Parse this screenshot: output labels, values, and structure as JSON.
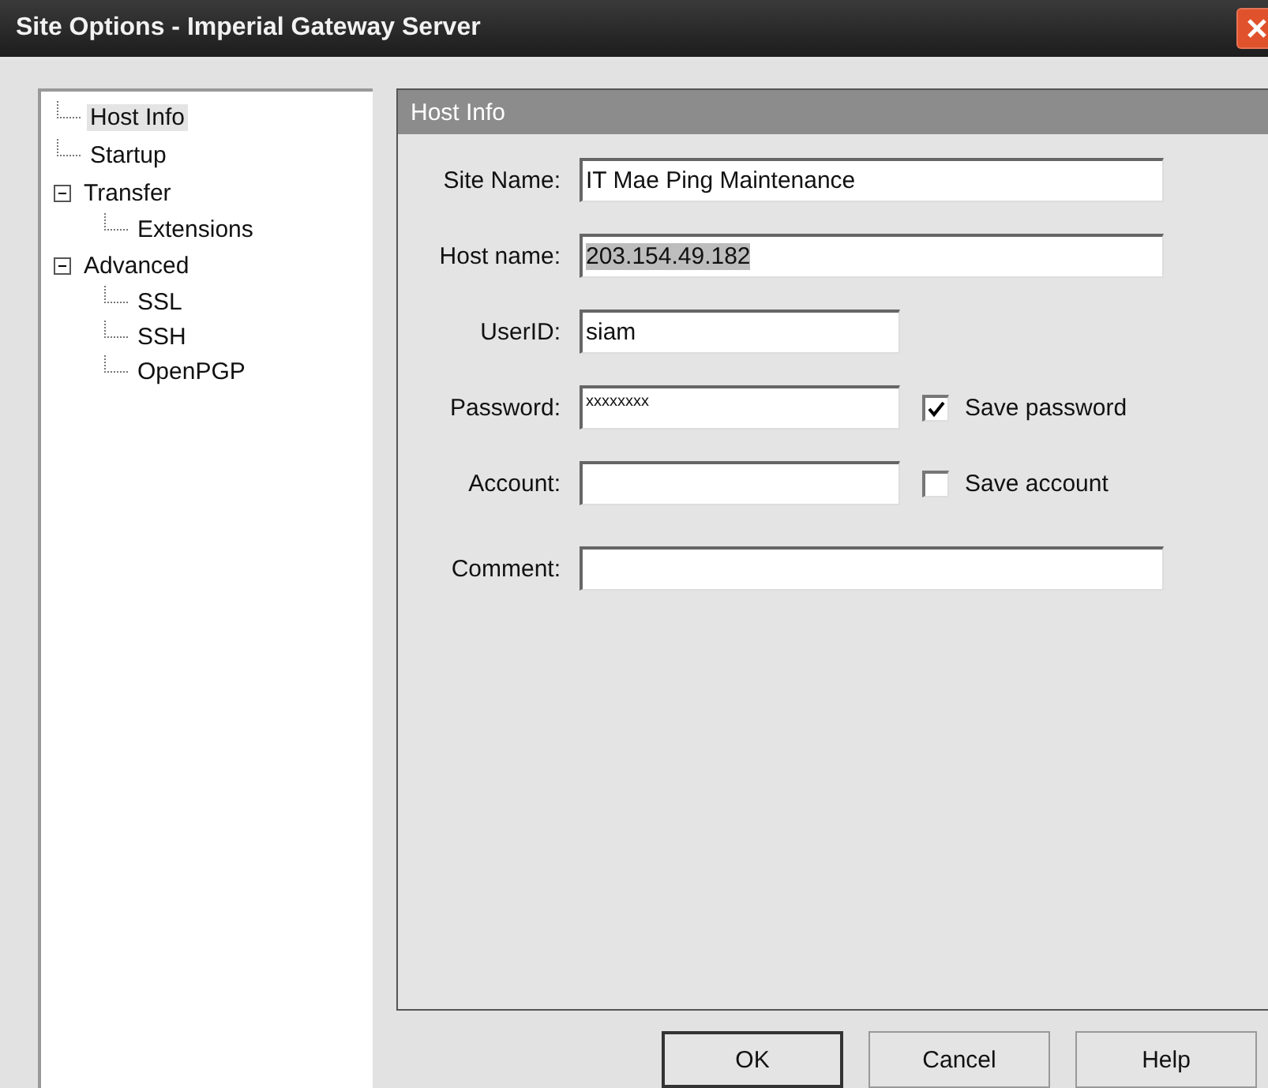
{
  "window": {
    "title": "Site Options - Imperial Gateway Server"
  },
  "tree": [
    {
      "label": "Host Info",
      "selected": true
    },
    {
      "label": "Startup",
      "selected": false
    },
    {
      "label": "Transfer",
      "selected": false,
      "expanded": true,
      "children": [
        {
          "label": "Extensions",
          "selected": false
        }
      ]
    },
    {
      "label": "Advanced",
      "selected": false,
      "expanded": true,
      "children": [
        {
          "label": "SSL",
          "selected": false
        },
        {
          "label": "SSH",
          "selected": false
        },
        {
          "label": "OpenPGP",
          "selected": false
        }
      ]
    }
  ],
  "panel": {
    "title": "Host Info",
    "fields": [
      {
        "label": "Site Name:",
        "kind": "wide",
        "value": "IT Mae Ping Maintenance"
      },
      {
        "label": "Host name:",
        "kind": "wide",
        "value": "203.154.49.182",
        "highlighted": true
      },
      {
        "label": "UserID:",
        "kind": "narrow",
        "value": "siam"
      },
      {
        "label": "Password:",
        "kind": "narrow",
        "value": "xxxxxxxx",
        "option": {
          "label": "Save password",
          "checked": true
        }
      },
      {
        "label": "Account:",
        "kind": "narrow",
        "option": {
          "label": "Save account",
          "checked": false
        }
      },
      {
        "label": "Comment:",
        "kind": "wide"
      }
    ]
  },
  "buttons": [
    {
      "label": "OK",
      "default": true
    },
    {
      "label": "Cancel",
      "default": false
    },
    {
      "label": "Help",
      "default": false
    }
  ]
}
